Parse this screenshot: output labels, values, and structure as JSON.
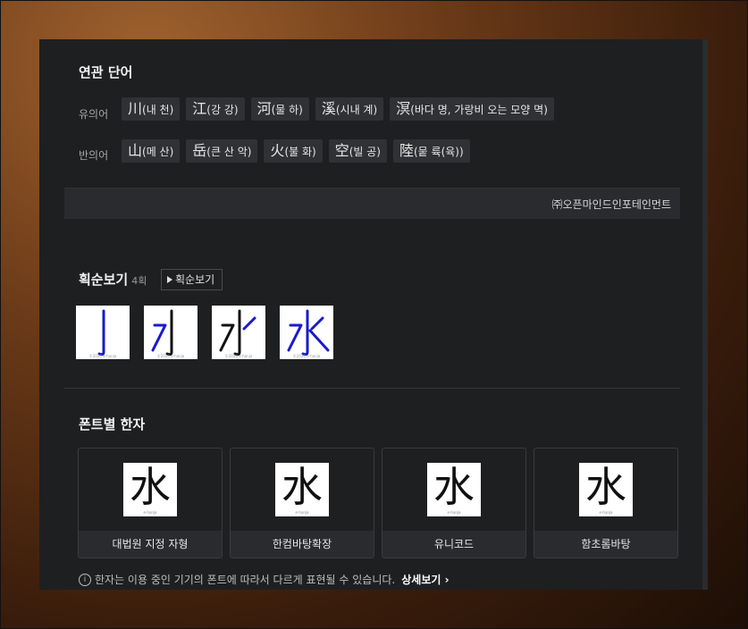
{
  "related": {
    "title": "연관 단어",
    "synonym_label": "유의어",
    "synonyms": [
      {
        "hanja": "川",
        "reading": "(내 천)"
      },
      {
        "hanja": "江",
        "reading": "(강 강)"
      },
      {
        "hanja": "河",
        "reading": "(물 하)"
      },
      {
        "hanja": "溪",
        "reading": "(시내 계)"
      },
      {
        "hanja": "溟",
        "reading": "(바다 명, 가랑비 오는 모양 멱)"
      }
    ],
    "antonym_label": "반의어",
    "antonyms": [
      {
        "hanja": "山",
        "reading": "(메 산)"
      },
      {
        "hanja": "岳",
        "reading": "(큰 산 악)"
      },
      {
        "hanja": "火",
        "reading": "(불 화)"
      },
      {
        "hanja": "空",
        "reading": "(빌 공)"
      },
      {
        "hanja": "陸",
        "reading": "(뭍 륙(육))"
      }
    ],
    "credit": "㈜오픈마인드인포테인먼트"
  },
  "stroke_order": {
    "title": "획순보기",
    "count": "4획",
    "play_label": "획순보기",
    "watermark": "©2020 e-hanja",
    "frames": [
      "亅",
      "㇇",
      "水",
      "水"
    ]
  },
  "fonts": {
    "title": "폰트별 한자",
    "hanja": "水",
    "watermark": "e-hanja",
    "cards": [
      {
        "caption": "대법원 지정 자형"
      },
      {
        "caption": "한컴바탕확장"
      },
      {
        "caption": "유니코드"
      },
      {
        "caption": "함초롬바탕"
      }
    ],
    "notice": "한자는 이용 중인 기기의 폰트에 따라서 다르게 표현될 수 있습니다.",
    "more_label": "상세보기 ›"
  },
  "colors": {
    "stroke": "#1a1acc",
    "panel": "#1e1f21",
    "chip": "#303134"
  }
}
